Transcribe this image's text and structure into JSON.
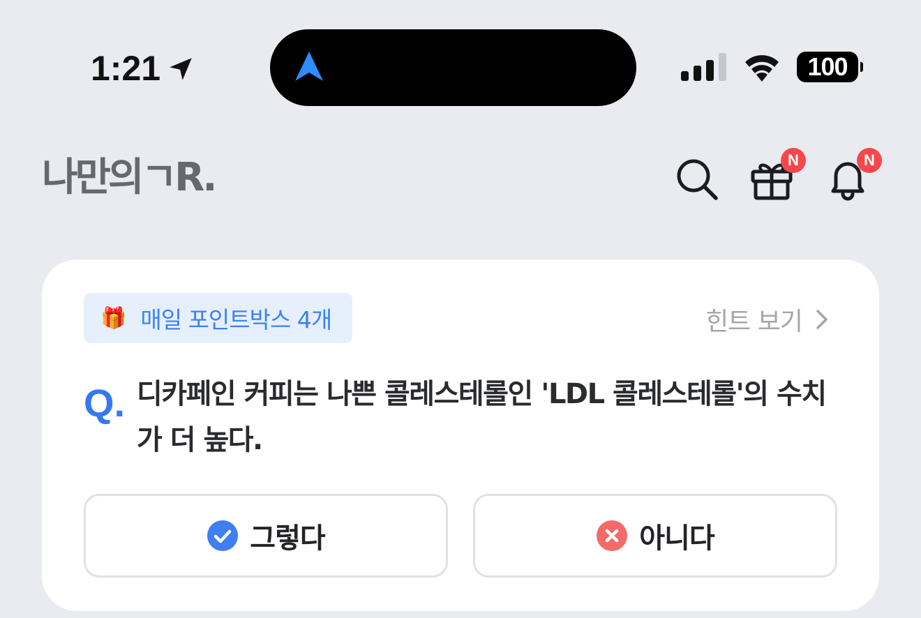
{
  "status_bar": {
    "time": "1:21",
    "battery": "100",
    "location_icon": "location-arrow-icon",
    "signal_icon": "cellular-signal-icon",
    "wifi_icon": "wifi-icon"
  },
  "header": {
    "logo": "나만의ㄱR.",
    "icons": [
      "search-icon",
      "gift-icon",
      "bell-icon"
    ],
    "gift_badge": "N",
    "bell_badge": "N"
  },
  "quiz": {
    "pointbox_emoji": "🎁",
    "pointbox_label": "매일 포인트박스 4개",
    "hint_label": "힌트 보기",
    "q_marker": "Q.",
    "question": "디카페인 커피는 나쁜 콜레스테롤인 'LDL 콜레스테롤'의 수치가 더 높다.",
    "answers": [
      {
        "label": "그렇다",
        "icon": "check-circle-icon",
        "color": "#3f7ef3"
      },
      {
        "label": "아니다",
        "icon": "x-circle-icon",
        "color": "#f36a6a"
      }
    ]
  },
  "colors": {
    "background": "#e9ebf0",
    "accent": "#3478f2",
    "badge": "#f6484c"
  }
}
